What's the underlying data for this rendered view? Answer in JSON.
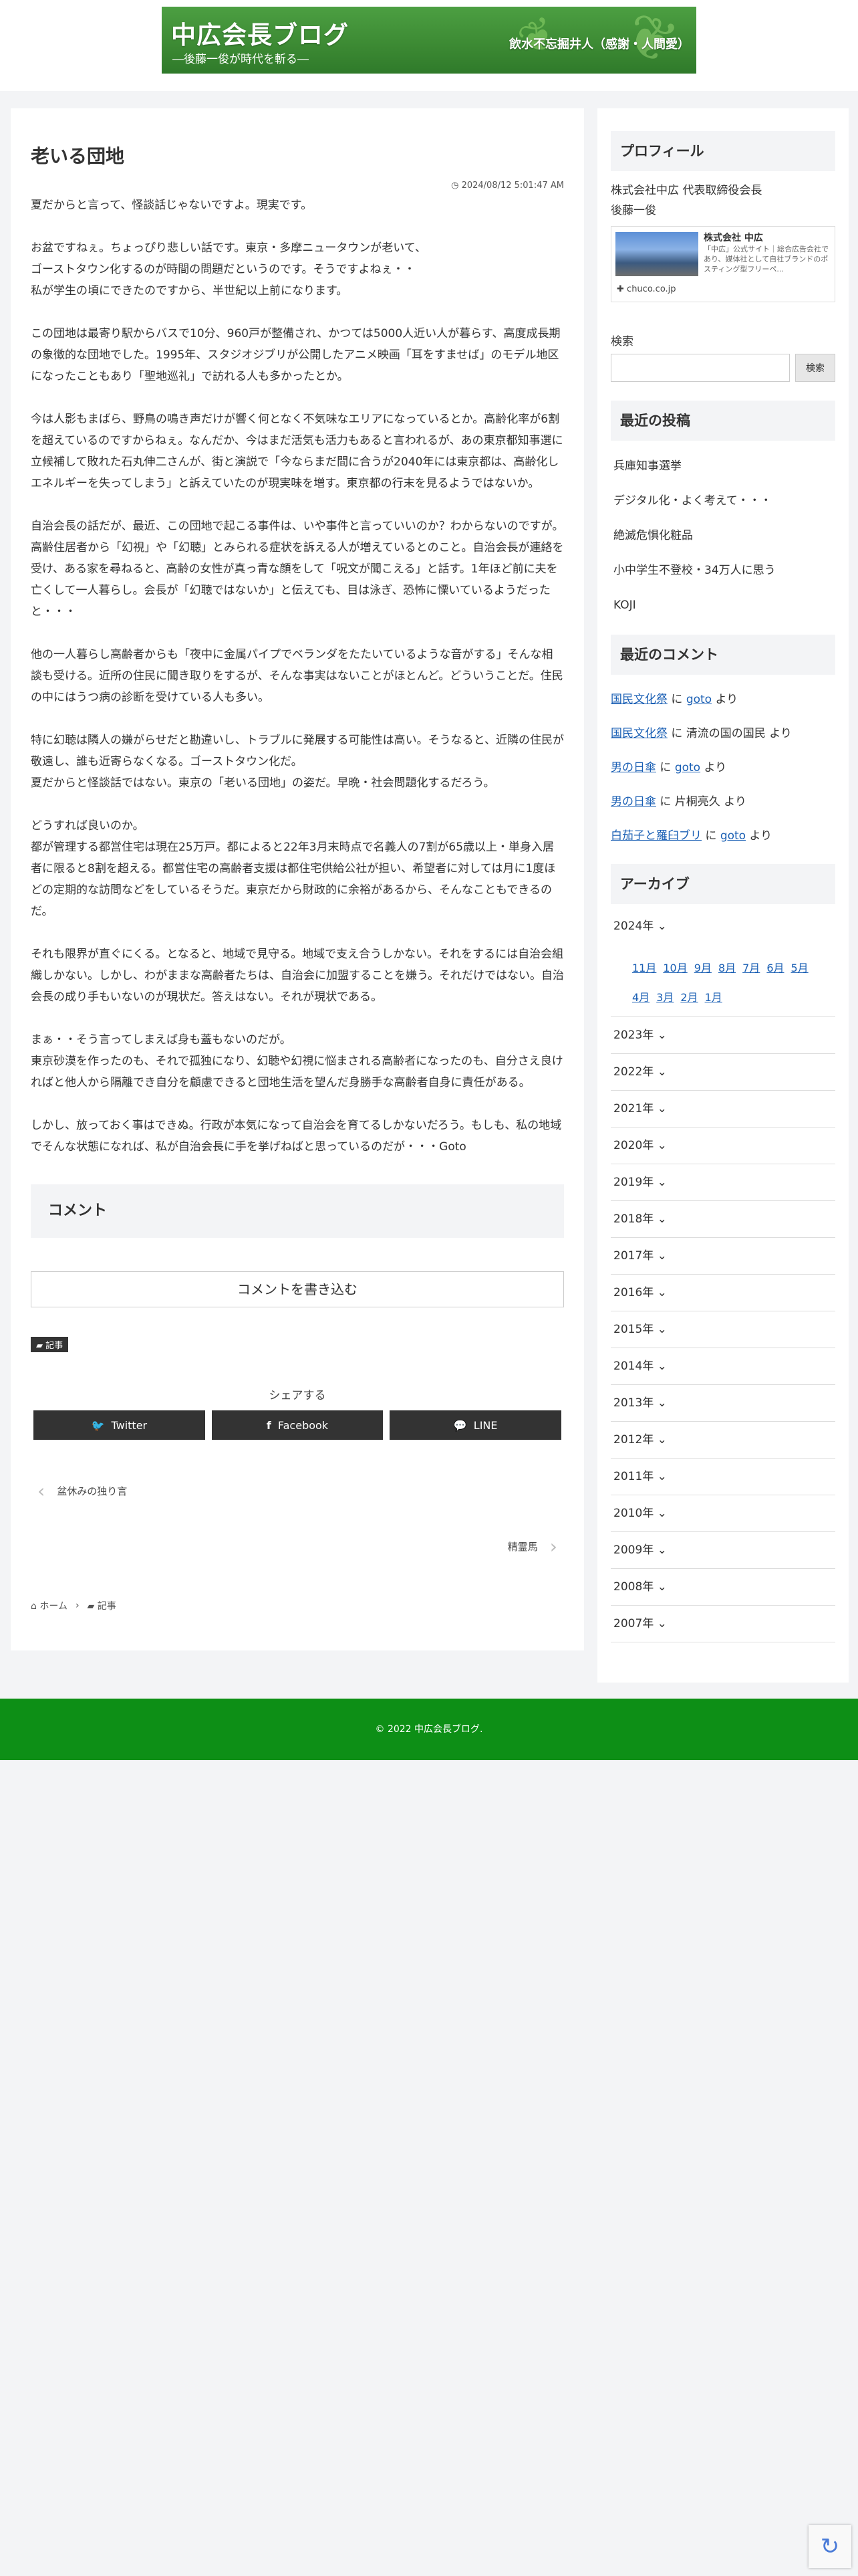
{
  "header": {
    "banner_title": "中広会長ブログ",
    "banner_subtitle": "―後藤一俊が時代を斬る―",
    "banner_motto": "飲水不忘掘井人（感謝・人間愛）"
  },
  "article": {
    "title": "老いる団地",
    "date": "2024/08/12 5:01:47 AM",
    "paragraphs": [
      "夏だからと言って、怪談話じゃないですよ。現実です。",
      "お盆ですねぇ。ちょっぴり悲しい話です。東京・多摩ニュータウンが老いて、\nゴーストタウン化するのが時間の問題だというのです。そうですよねぇ・・\n私が学生の頃にできたのですから、半世紀以上前になります。",
      "この団地は最寄り駅からバスで10分、960戸が整備され、かつては5000人近い人が暮らす、高度成長期の象徴的な団地でした。1995年、スタジオジブリが公開したアニメ映画「耳をすませば」のモデル地区になったこともあり「聖地巡礼」で訪れる人も多かったとか。",
      "今は人影もまばら、野鳥の鳴き声だけが響く何となく不気味なエリアになっているとか。高齢化率が6割を超えているのですからねぇ。なんだか、今はまだ活気も活力もあると言われるが、あの東京都知事選に立候補して敗れた石丸伸二さんが、街と演説で「今ならまだ間に合うが2040年には東京都は、高齢化しエネルギーを失ってしまう」と訴えていたのが現実味を増す。東京都の行末を見るようではないか。",
      "自治会長の話だが、最近、この団地で起こる事件は、いや事件と言っていいのか？わからないのですが。高齢住居者から「幻視」や「幻聴」とみられる症状を訴える人が増えているとのこと。自治会長が連絡を受け、ある家を尋ねると、高齢の女性が真っ青な顔をして「呪文が聞こえる」と話す。1年ほど前に夫を亡くして一人暮らし。会長が「幻聴ではないか」と伝えても、目は泳ぎ、恐怖に慄いているようだったと・・・",
      "他の一人暮らし高齢者からも「夜中に金属パイプでベランダをたたいているような音がする」そんな相談も受ける。近所の住民に聞き取りをするが、そんな事実はないことがほとんど。どういうことだ。住民の中にはうつ病の診断を受けている人も多い。",
      "特に幻聴は隣人の嫌がらせだと勘違いし、トラブルに発展する可能性は高い。そうなると、近隣の住民が敬遠し、誰も近寄らなくなる。ゴーストタウン化だ。\n夏だからと怪談話ではない。東京の「老いる団地」の姿だ。早晩・社会問題化するだろう。",
      "どうすれば良いのか。\n都が管理する都営住宅は現在25万戸。都によると22年3月末時点で名義人の7割が65歳以上・単身入居者に限ると8割を超える。都営住宅の高齢者支援は都住宅供給公社が担い、希望者に対しては月に1度ほどの定期的な訪問などをしているそうだ。東京だから財政的に余裕があるから、そんなこともできるのだ。",
      "それも限界が直ぐにくる。となると、地域で見守る。地域で支え合うしかない。それをするには自治会組織しかない。しかし、わがままな高齢者たちは、自治会に加盟することを嫌う。それだけではない。自治会長の成り手もいないのが現状だ。答えはない。それが現状である。",
      "まぁ・・そう言ってしまえば身も蓋もないのだが。\n東京砂漠を作ったのも、それで孤独になり、幻聴や幻視に悩まされる高齢者になったのも、自分さえ良ければと他人から隔離でき自分を顧慮できると団地生活を望んだ身勝手な高齢者自身に責任がある。",
      "しかし、放っておく事はできぬ。行政が本気になって自治会を育てるしかないだろう。もしも、私の地域でそんな状態になれば、私が自治会長に手を挙げねばと思っているのだが・・・Goto"
    ]
  },
  "comments_section": {
    "heading": "コメント",
    "write_button": "コメントを書き込む"
  },
  "category_tag": "記事",
  "share": {
    "label": "シェアする",
    "buttons": [
      {
        "label": "Twitter",
        "icon": "twitter-bird-icon"
      },
      {
        "label": "Facebook",
        "icon": "facebook-f-icon"
      },
      {
        "label": "LINE",
        "icon": "line-bubble-icon"
      }
    ]
  },
  "post_nav": {
    "prev_label": "盆休みの独り言",
    "next_label": "精霊馬"
  },
  "breadcrumb": {
    "home": "ホーム",
    "category": "記事"
  },
  "sidebar": {
    "profile": {
      "heading": "プロフィール",
      "line1": "株式会社中広 代表取締役会長",
      "line2": "後藤一俊",
      "card_title": "株式会社 中広",
      "card_desc": "「中広」公式サイト｜総合広告会社であり、媒体社として自社ブランドのポスティング型フリーペ...",
      "card_url": "chuco.co.jp"
    },
    "search": {
      "label": "検索",
      "placeholder": "",
      "button": "検索"
    },
    "recent_posts": {
      "heading": "最近の投稿",
      "items": [
        "兵庫知事選挙",
        "デジタル化・よく考えて・・・",
        "絶滅危惧化粧品",
        "小中学生不登校・34万人に思う",
        "KOJI"
      ]
    },
    "recent_comments": {
      "heading": "最近のコメント",
      "items": [
        {
          "link": "国民文化祭",
          "mid": " に ",
          "author": "goto",
          "tail": " より",
          "author_link": true
        },
        {
          "link": "国民文化祭",
          "mid": " に ",
          "author": "清流の国の国民",
          "tail": " より",
          "author_link": false
        },
        {
          "link": "男の日傘",
          "mid": " に ",
          "author": "goto",
          "tail": " より",
          "author_link": true
        },
        {
          "link": "男の日傘",
          "mid": " に ",
          "author": "片桐亮久",
          "tail": " より",
          "author_link": false
        },
        {
          "link": "白茄子と羅臼ブリ",
          "mid": " に ",
          "author": "goto",
          "tail": " より",
          "author_link": true
        }
      ]
    },
    "archive": {
      "heading": "アーカイブ",
      "open_year": "2024年",
      "months_row1": [
        "11月",
        "10月",
        "9月",
        "8月",
        "7月",
        "6月",
        "5月"
      ],
      "months_row2": [
        "4月",
        "3月",
        "2月",
        "1月"
      ],
      "years": [
        "2023年",
        "2022年",
        "2021年",
        "2020年",
        "2019年",
        "2018年",
        "2017年",
        "2016年",
        "2015年",
        "2014年",
        "2013年",
        "2012年",
        "2011年",
        "2010年",
        "2009年",
        "2008年",
        "2007年"
      ]
    }
  },
  "footer": {
    "copyright": "© 2022 中広会長ブログ."
  }
}
